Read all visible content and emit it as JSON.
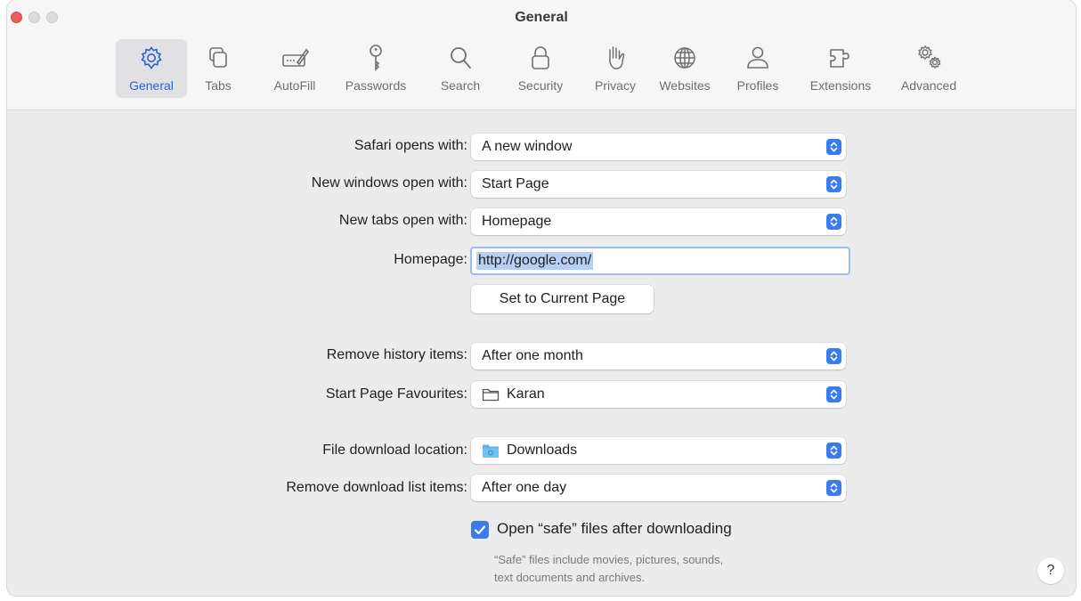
{
  "window": {
    "title": "General"
  },
  "toolbar": {
    "items": [
      {
        "label": "General",
        "icon": "gear-icon",
        "active": true
      },
      {
        "label": "Tabs",
        "icon": "tabs-icon"
      },
      {
        "label": "AutoFill",
        "icon": "autofill-pencil-icon"
      },
      {
        "label": "Passwords",
        "icon": "key-icon"
      },
      {
        "label": "Search",
        "icon": "magnifier-icon"
      },
      {
        "label": "Security",
        "icon": "lock-icon"
      },
      {
        "label": "Privacy",
        "icon": "hand-icon"
      },
      {
        "label": "Websites",
        "icon": "globe-icon"
      },
      {
        "label": "Profiles",
        "icon": "person-icon"
      },
      {
        "label": "Extensions",
        "icon": "puzzle-icon"
      },
      {
        "label": "Advanced",
        "icon": "gears-icon"
      }
    ]
  },
  "settings": {
    "safari_opens": {
      "label": "Safari opens with:",
      "value": "A new window"
    },
    "new_windows": {
      "label": "New windows open with:",
      "value": "Start Page"
    },
    "new_tabs": {
      "label": "New tabs open with:",
      "value": "Homepage"
    },
    "homepage": {
      "label": "Homepage:",
      "value": "http://google.com/"
    },
    "set_current_button": "Set to Current Page",
    "remove_history": {
      "label": "Remove history items:",
      "value": "After one month"
    },
    "start_page_favourites": {
      "label": "Start Page Favourites:",
      "value": "Karan",
      "icon": "folder-outline-icon"
    },
    "download_location": {
      "label": "File download location:",
      "value": "Downloads",
      "icon": "downloads-folder-icon"
    },
    "remove_download": {
      "label": "Remove download list items:",
      "value": "After one day"
    },
    "open_safe": {
      "label": "Open “safe” files after downloading",
      "checked": true
    },
    "safe_note_line1": "“Safe” files include movies, pictures, sounds,",
    "safe_note_line2": "text documents and archives."
  },
  "help": {
    "label": "?"
  },
  "colors": {
    "accent": "#3a7cf0",
    "close": "#ec5f57",
    "active_label": "#2a62d6"
  }
}
